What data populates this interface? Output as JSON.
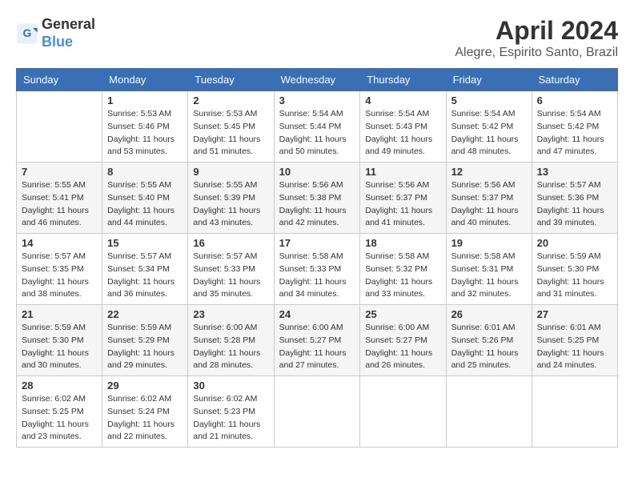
{
  "header": {
    "logo_line1": "General",
    "logo_line2": "Blue",
    "month": "April 2024",
    "location": "Alegre, Espirito Santo, Brazil"
  },
  "weekdays": [
    "Sunday",
    "Monday",
    "Tuesday",
    "Wednesday",
    "Thursday",
    "Friday",
    "Saturday"
  ],
  "weeks": [
    [
      {
        "day": "",
        "info": ""
      },
      {
        "day": "1",
        "info": "Sunrise: 5:53 AM\nSunset: 5:46 PM\nDaylight: 11 hours\nand 53 minutes."
      },
      {
        "day": "2",
        "info": "Sunrise: 5:53 AM\nSunset: 5:45 PM\nDaylight: 11 hours\nand 51 minutes."
      },
      {
        "day": "3",
        "info": "Sunrise: 5:54 AM\nSunset: 5:44 PM\nDaylight: 11 hours\nand 50 minutes."
      },
      {
        "day": "4",
        "info": "Sunrise: 5:54 AM\nSunset: 5:43 PM\nDaylight: 11 hours\nand 49 minutes."
      },
      {
        "day": "5",
        "info": "Sunrise: 5:54 AM\nSunset: 5:42 PM\nDaylight: 11 hours\nand 48 minutes."
      },
      {
        "day": "6",
        "info": "Sunrise: 5:54 AM\nSunset: 5:42 PM\nDaylight: 11 hours\nand 47 minutes."
      }
    ],
    [
      {
        "day": "7",
        "info": "Sunrise: 5:55 AM\nSunset: 5:41 PM\nDaylight: 11 hours\nand 46 minutes."
      },
      {
        "day": "8",
        "info": "Sunrise: 5:55 AM\nSunset: 5:40 PM\nDaylight: 11 hours\nand 44 minutes."
      },
      {
        "day": "9",
        "info": "Sunrise: 5:55 AM\nSunset: 5:39 PM\nDaylight: 11 hours\nand 43 minutes."
      },
      {
        "day": "10",
        "info": "Sunrise: 5:56 AM\nSunset: 5:38 PM\nDaylight: 11 hours\nand 42 minutes."
      },
      {
        "day": "11",
        "info": "Sunrise: 5:56 AM\nSunset: 5:37 PM\nDaylight: 11 hours\nand 41 minutes."
      },
      {
        "day": "12",
        "info": "Sunrise: 5:56 AM\nSunset: 5:37 PM\nDaylight: 11 hours\nand 40 minutes."
      },
      {
        "day": "13",
        "info": "Sunrise: 5:57 AM\nSunset: 5:36 PM\nDaylight: 11 hours\nand 39 minutes."
      }
    ],
    [
      {
        "day": "14",
        "info": "Sunrise: 5:57 AM\nSunset: 5:35 PM\nDaylight: 11 hours\nand 38 minutes."
      },
      {
        "day": "15",
        "info": "Sunrise: 5:57 AM\nSunset: 5:34 PM\nDaylight: 11 hours\nand 36 minutes."
      },
      {
        "day": "16",
        "info": "Sunrise: 5:57 AM\nSunset: 5:33 PM\nDaylight: 11 hours\nand 35 minutes."
      },
      {
        "day": "17",
        "info": "Sunrise: 5:58 AM\nSunset: 5:33 PM\nDaylight: 11 hours\nand 34 minutes."
      },
      {
        "day": "18",
        "info": "Sunrise: 5:58 AM\nSunset: 5:32 PM\nDaylight: 11 hours\nand 33 minutes."
      },
      {
        "day": "19",
        "info": "Sunrise: 5:58 AM\nSunset: 5:31 PM\nDaylight: 11 hours\nand 32 minutes."
      },
      {
        "day": "20",
        "info": "Sunrise: 5:59 AM\nSunset: 5:30 PM\nDaylight: 11 hours\nand 31 minutes."
      }
    ],
    [
      {
        "day": "21",
        "info": "Sunrise: 5:59 AM\nSunset: 5:30 PM\nDaylight: 11 hours\nand 30 minutes."
      },
      {
        "day": "22",
        "info": "Sunrise: 5:59 AM\nSunset: 5:29 PM\nDaylight: 11 hours\nand 29 minutes."
      },
      {
        "day": "23",
        "info": "Sunrise: 6:00 AM\nSunset: 5:28 PM\nDaylight: 11 hours\nand 28 minutes."
      },
      {
        "day": "24",
        "info": "Sunrise: 6:00 AM\nSunset: 5:27 PM\nDaylight: 11 hours\nand 27 minutes."
      },
      {
        "day": "25",
        "info": "Sunrise: 6:00 AM\nSunset: 5:27 PM\nDaylight: 11 hours\nand 26 minutes."
      },
      {
        "day": "26",
        "info": "Sunrise: 6:01 AM\nSunset: 5:26 PM\nDaylight: 11 hours\nand 25 minutes."
      },
      {
        "day": "27",
        "info": "Sunrise: 6:01 AM\nSunset: 5:25 PM\nDaylight: 11 hours\nand 24 minutes."
      }
    ],
    [
      {
        "day": "28",
        "info": "Sunrise: 6:02 AM\nSunset: 5:25 PM\nDaylight: 11 hours\nand 23 minutes."
      },
      {
        "day": "29",
        "info": "Sunrise: 6:02 AM\nSunset: 5:24 PM\nDaylight: 11 hours\nand 22 minutes."
      },
      {
        "day": "30",
        "info": "Sunrise: 6:02 AM\nSunset: 5:23 PM\nDaylight: 11 hours\nand 21 minutes."
      },
      {
        "day": "",
        "info": ""
      },
      {
        "day": "",
        "info": ""
      },
      {
        "day": "",
        "info": ""
      },
      {
        "day": "",
        "info": ""
      }
    ]
  ]
}
